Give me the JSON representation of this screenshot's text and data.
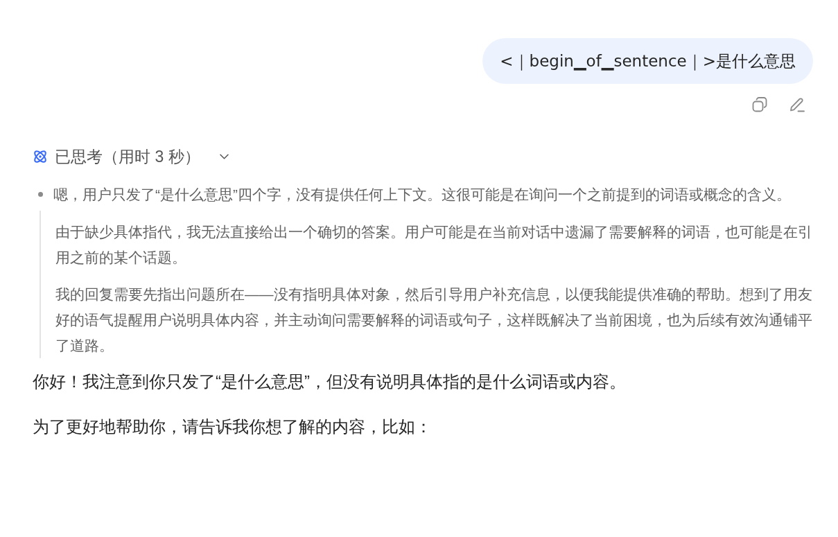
{
  "user_message": {
    "text": "<｜begin▁of▁sentence｜>是什么意思"
  },
  "thinking": {
    "label": "已思考（用时 3 秒）",
    "expanded": true,
    "items": [
      {
        "kind": "bullet",
        "text": "嗯，用户只发了“是什么意思”四个字，没有提供任何上下文。这很可能是在询问一个之前提到的词语或概念的含义。"
      },
      {
        "kind": "quote",
        "text": "由于缺少具体指代，我无法直接给出一个确切的答案。用户可能是在当前对话中遗漏了需要解释的词语，也可能是在引用之前的某个话题。"
      },
      {
        "kind": "quote",
        "text": "我的回复需要先指出问题所在——没有指明具体对象，然后引导用户补充信息，以便我能提供准确的帮助。想到了用友好的语气提醒用户说明具体内容，并主动询问需要解释的词语或句子，这样既解决了当前困境，也为后续有效沟通铺平了道路。"
      }
    ]
  },
  "answer": {
    "paragraphs": [
      "你好！我注意到你只发了“是什么意思”，但没有说明具体指的是什么词语或内容。",
      "为了更好地帮助你，请告诉我你想了解的内容，比如："
    ]
  }
}
